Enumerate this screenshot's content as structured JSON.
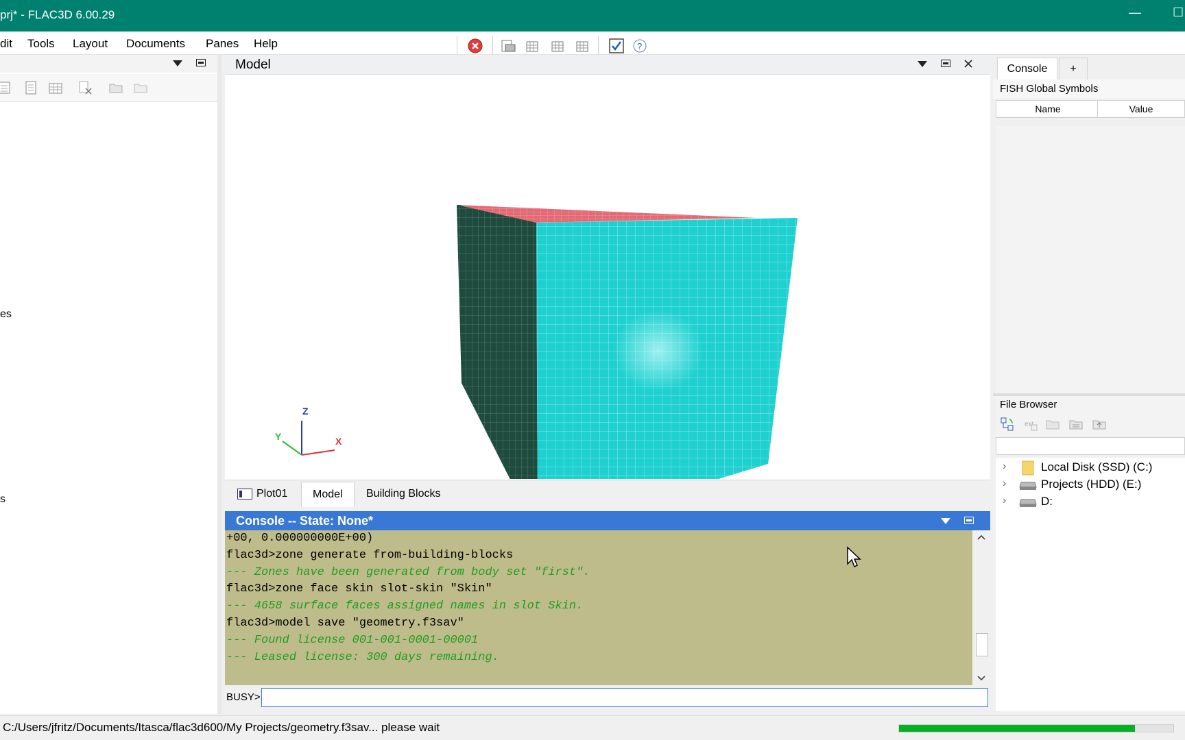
{
  "window": {
    "title": "prj* - FLAC3D 6.00.29"
  },
  "menu": {
    "items": [
      "dit",
      "Tools",
      "Layout",
      "Documents",
      "Panes",
      "Help"
    ]
  },
  "model_pane": {
    "title": "Model",
    "axes": {
      "z": "Z",
      "y": "Y",
      "x": "X"
    },
    "tabs": [
      "Plot01",
      "Model",
      "Building Blocks"
    ],
    "active_tab": "Model"
  },
  "left_pane": {
    "fragment_1": "es",
    "fragment_2": "s"
  },
  "console": {
    "title": "Console -- State: None*",
    "lines": [
      {
        "text": "+00, 0.000000000E+00)",
        "kind": "cmd"
      },
      {
        "text": "flac3d>zone generate from-building-blocks",
        "kind": "cmd"
      },
      {
        "text": "--- Zones have been generated from body set \"first\".",
        "kind": "msg"
      },
      {
        "text": "flac3d>zone face skin slot-skin \"Skin\"",
        "kind": "cmd"
      },
      {
        "text": "--- 4658 surface faces assigned names in slot Skin.",
        "kind": "msg"
      },
      {
        "text": "flac3d>model save \"geometry.f3sav\"",
        "kind": "cmd"
      },
      {
        "text": "--- Found license 001-001-0001-00001",
        "kind": "msg"
      },
      {
        "text": "--- Leased license: 300 days remaining.",
        "kind": "msg"
      }
    ],
    "prompt": "BUSY>",
    "input_value": ""
  },
  "right_pane": {
    "tabs": [
      "Console",
      "+"
    ],
    "fish_title": "FISH Global Symbols",
    "columns": [
      "Name",
      "Value"
    ],
    "file_browser_title": "File Browser",
    "file_browser_path": "",
    "drives": [
      {
        "label": "Local Disk (SSD) (C:)",
        "icon": "folder-icon"
      },
      {
        "label": "Projects (HDD) (E:)",
        "icon": "drive-icon"
      },
      {
        "label": "D:",
        "icon": "drive-icon"
      }
    ]
  },
  "status": {
    "text": "C:/Users/jfritz/Documents/Itasca/flac3d600/My Projects/geometry.f3sav... please wait",
    "progress": 0.86
  },
  "colors": {
    "titlebar": "#00816f",
    "cube_front": "#1fd0d0",
    "cube_side": "#1f4a3e",
    "cube_top": "#e36a74",
    "console_bg": "#bfbc8c",
    "console_header": "#3a78d6",
    "console_msg": "#1f9d1f",
    "progress": "#06b025"
  }
}
